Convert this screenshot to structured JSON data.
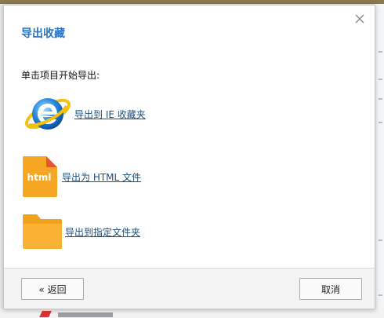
{
  "dialog": {
    "title": "导出收藏",
    "instruction": "单击项目开始导出:",
    "options": [
      {
        "label": "导出到 IE 收藏夹",
        "icon": "internet-explorer-icon"
      },
      {
        "label": "导出为 HTML 文件",
        "icon": "html-file-icon",
        "badge": "html"
      },
      {
        "label": "导出到指定文件夹",
        "icon": "folder-icon"
      }
    ],
    "buttons": {
      "back": "« 返回",
      "cancel": "取消"
    }
  },
  "colors": {
    "title": "#2b73c4",
    "link": "#1f4e79",
    "html_icon": "#f5a623",
    "folder_icon": "#f9b233",
    "ie_blue": "#1e88e5",
    "ie_ring": "#f4c20d"
  }
}
